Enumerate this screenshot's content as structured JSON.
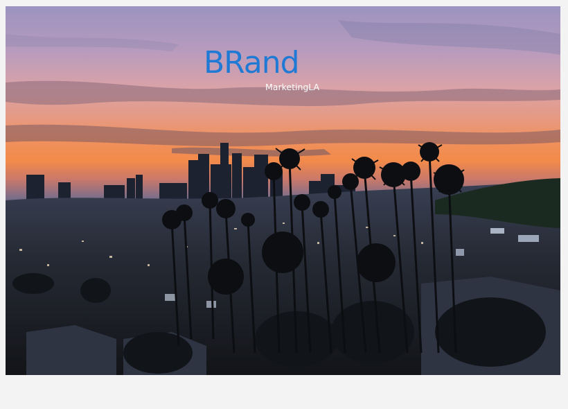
{
  "hero": {
    "image_description_icon": "city-skyline-photo",
    "logo": {
      "main": "BRand",
      "sub": "MarketingLA",
      "color": "#1f7ad6"
    }
  }
}
